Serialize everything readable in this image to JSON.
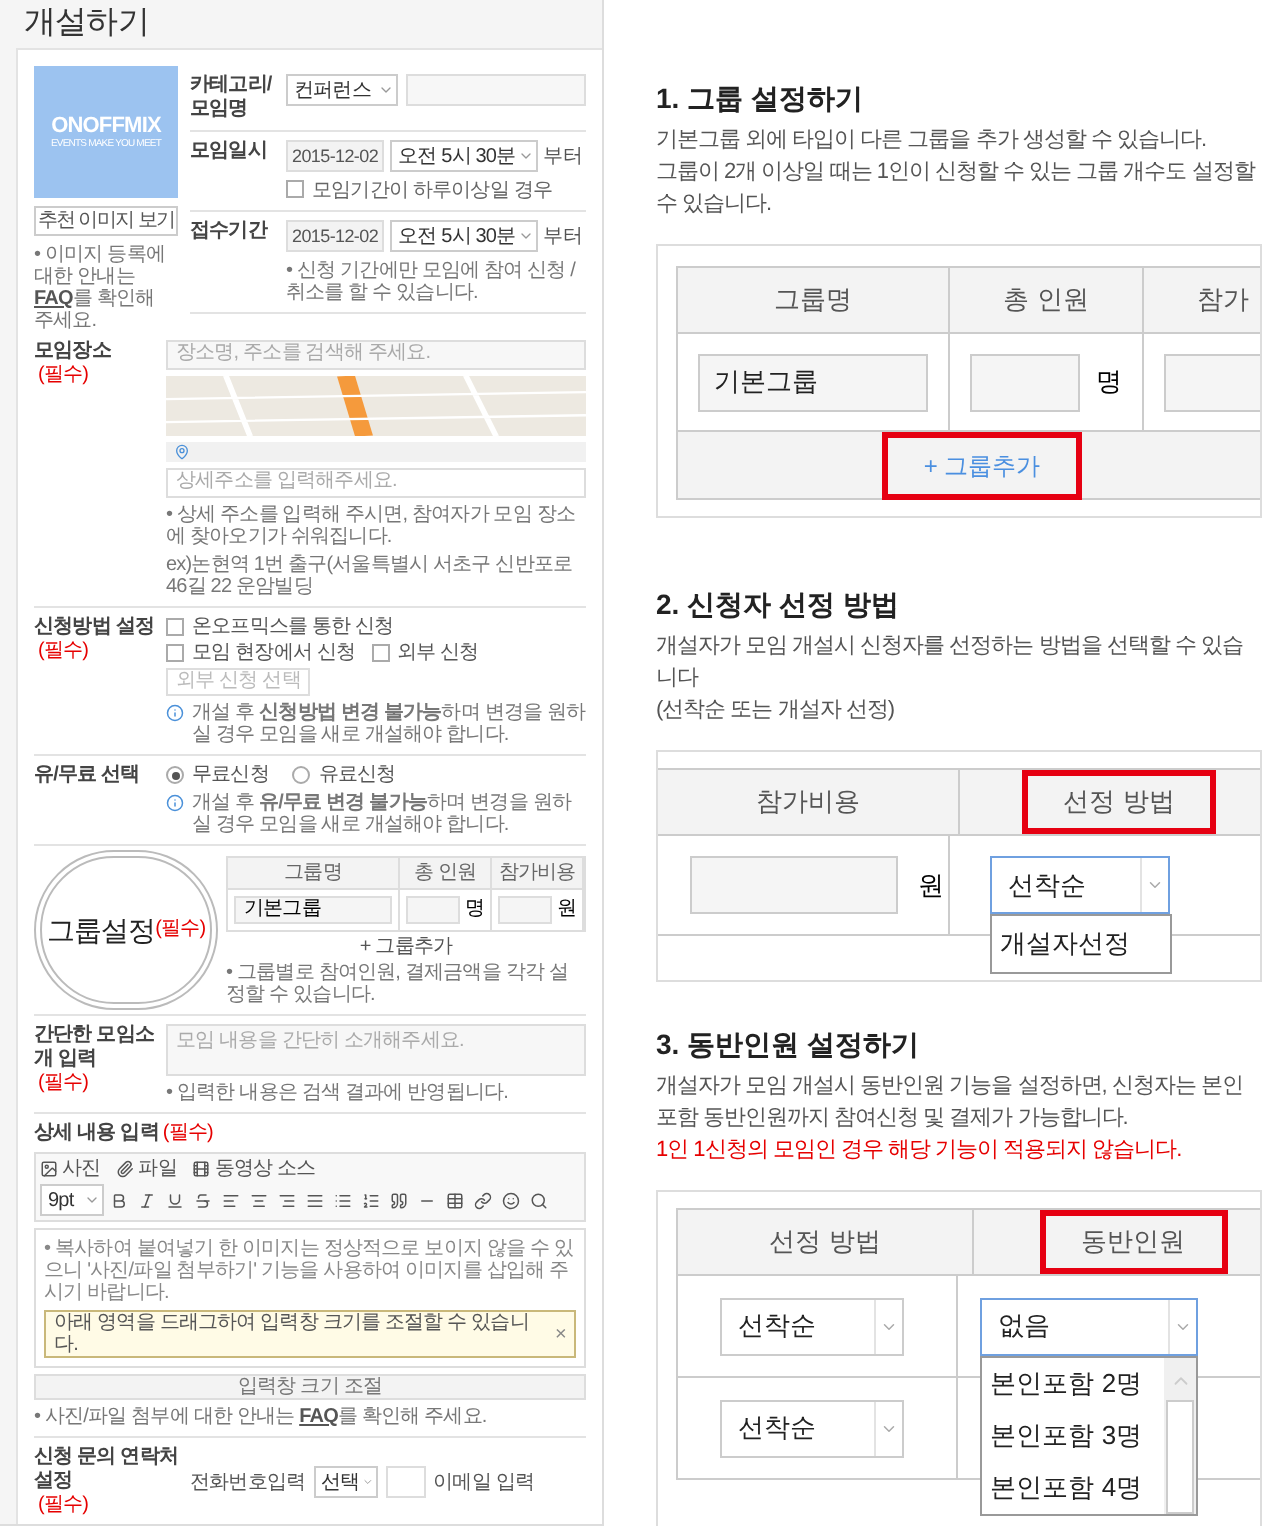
{
  "page_title": "개설하기",
  "cover": {
    "logo": "ONOFFMIX",
    "tagline": "EVENTS MAKE YOU MEET",
    "button": "추천 이미지 보기",
    "note_before": "• 이미지 등록에 대한 안내는",
    "note_link": "FAQ",
    "note_after": "를 확인해 주세요."
  },
  "top_rows": [
    {
      "kind": "select",
      "label": "카테고리/모임명",
      "value": "컨퍼런스"
    },
    {
      "kind": "datetime",
      "label": "모임일시",
      "date": "2015-12-02",
      "time": "오전 5시 30분",
      "suffix": "부터",
      "checkbox": {
        "label": "모임기간이 하루이상일 경우",
        "checked": false
      }
    },
    {
      "kind": "datetime",
      "label": "접수기간",
      "date": "2015-12-02",
      "time": "오전 5시 30분",
      "suffix": "부터",
      "note": "• 신청 기간에만 모임에 참여 신청 / 취소를 할 수 있습니다."
    }
  ],
  "place": {
    "label": "모임장소",
    "required": "(필수)",
    "search_placeholder": "장소명, 주소를 검색해 주세요.",
    "detail_placeholder": "상세주소를 입력해주세요.",
    "notes": [
      "• 상세 주소를 입력해 주시면, 참여자가 모임 장소에 찾아오기가 쉬워집니다.",
      "ex)논현역 1번 출구(서울특별시 서초구 신반포로 46길 22 운암빌딩"
    ]
  },
  "apply_method": {
    "label": "신청방법 설정",
    "required": "(필수)",
    "options": [
      {
        "label": "온오프믹스를 통한 신청",
        "checked": false
      },
      {
        "label": "모임 현장에서 신청",
        "checked": false
      },
      {
        "label": "외부 신청",
        "checked": false
      }
    ],
    "external_placeholder": "외부 신청 선택",
    "note": "개설 후 **신청방법 변경 불가능**하며 변경을 원하실 경우 모임을 새로 개설해야 합니다."
  },
  "fee_type": {
    "label": "유/무료 선택",
    "options": [
      {
        "label": "무료신청",
        "selected": true
      },
      {
        "label": "유료신청",
        "selected": false
      }
    ],
    "note": "개설 후 **유/무료 변경 불가능**하며 변경을 원하실 경우 모임을 새로 개설해야 합니다."
  },
  "group_setting": {
    "label": "그룹설정",
    "required": "(필수)",
    "columns": [
      "그룹명",
      "총 인원",
      "참가비용"
    ],
    "name": "기본그룹",
    "count_unit": "명",
    "fee_unit": "원",
    "add_button": "+ 그룹추가",
    "note": "• 그룹별로 참여인원, 결제금액을 각각 설정할 수 있습니다."
  },
  "summary": {
    "label": "간단한 모임소개 입력",
    "required": "(필수)",
    "placeholder": "모임 내용을 간단히 소개해주세요.",
    "note": "• 입력한 내용은 검색 결과에 반영됩니다."
  },
  "detail": {
    "label": "상세 내용 입력",
    "required": "(필수)",
    "attachments": [
      "사진",
      "파일",
      "동영상 소스"
    ],
    "font_size": "9pt",
    "content": "• 복사하여 붙여넣기 한 이미지는 정상적으로 보이지 않을 수 있으니 '사진/파일 첨부하기' 기능을 사용하여 이미지를 삽입해 주시기 바랍니다.",
    "tooltip": "아래 영역을 드래그하여 입력창 크기를 조절할 수 있습니다.",
    "tooltip_close": "×",
    "resize": "입력창 크기 조절",
    "note_before": "• 사진/파일 첨부에 대한 안내는",
    "note_link": "FAQ",
    "note_after": "를 확인해 주세요."
  },
  "contact": {
    "label": "신청 문의 연락처 설정",
    "required": "(필수)",
    "phone_label": "전화번호입력",
    "phone_select": "선택",
    "email_label": "이메일 입력"
  },
  "guides": [
    {
      "kind": "group",
      "title": "1. 그룹 설정하기",
      "description": [
        "기본그룹 외에 타입이 다른 그룹을 추가 생성할 수 있습니다.",
        "그룹이 2개 이상일 때는 1인이 신청할 수 있는 그룹 개수도 설정할 수 있습니다."
      ],
      "columns": [
        {
          "label": "그룹명",
          "highlighted": false
        },
        {
          "label": "총 인원",
          "highlighted": false
        },
        {
          "label": "참가",
          "highlighted": false
        }
      ],
      "name": "기본그룹",
      "unit": "명",
      "add_button": {
        "label": "+ 그룹추가",
        "highlighted": true
      }
    },
    {
      "kind": "method",
      "title": "2. 신청자 선정 방법",
      "description": [
        "개설자가 모임 개설시 신청자를 선정하는 방법을 선택할 수 있습니다",
        "(선착순 또는 개설자 선정)"
      ],
      "columns": [
        {
          "label": "참가비용",
          "highlighted": false
        },
        {
          "label": "선정 방법",
          "highlighted": true
        }
      ],
      "unit": "원",
      "select": {
        "value": "선착순",
        "expanded": true,
        "options": [
          "개설자선정"
        ]
      }
    },
    {
      "kind": "companion",
      "title": "3. 동반인원 설정하기",
      "description": [
        "개설자가 모임 개설시 동반인원 기능을 설정하면, 신청자는 본인 포함 동반인원까지 참여신청 및 결제가 가능합니다."
      ],
      "warning": "1인 1신청의 모임인 경우 해당 기능이 적용되지 않습니다.",
      "columns": [
        {
          "label": "선정 방법",
          "highlighted": false
        },
        {
          "label": "동반인원",
          "highlighted": true
        }
      ],
      "rows": [
        {
          "method": "선착순",
          "companion": {
            "value": "없음",
            "expanded": true,
            "options": [
              "본인포함 2명",
              "본인포함 3명",
              "본인포함 4명"
            ]
          }
        },
        {
          "method": "선착순"
        }
      ]
    }
  ]
}
